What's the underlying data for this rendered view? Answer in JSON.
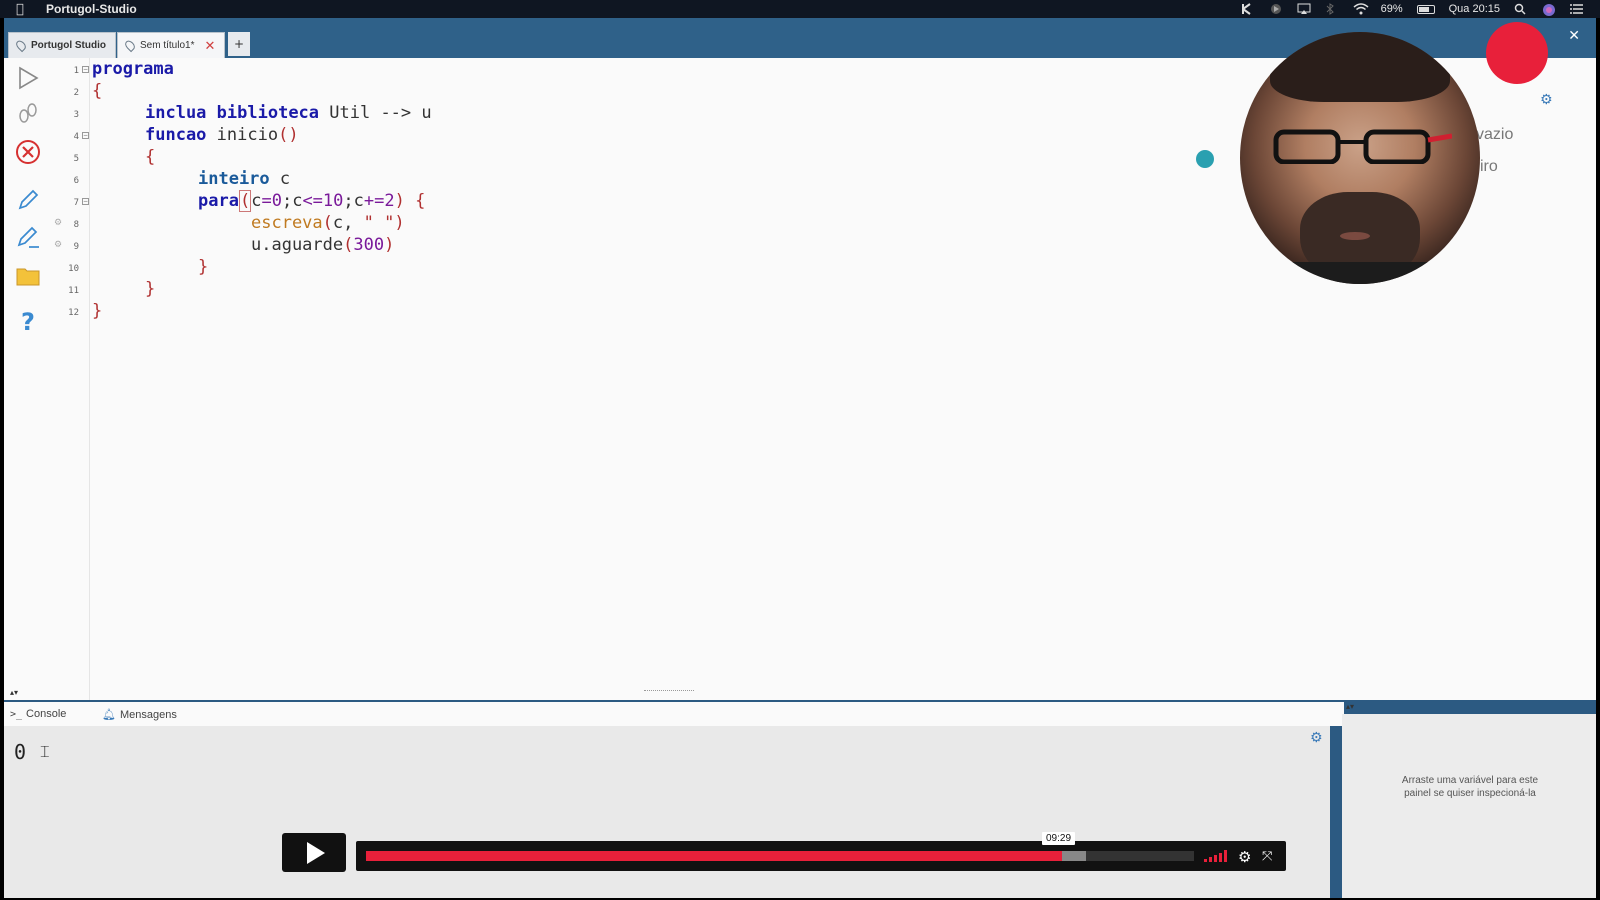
{
  "menubar": {
    "app_name": "Portugol-Studio",
    "battery": "69%",
    "clock": "Qua 20:15"
  },
  "tabs": {
    "home_label": "Portugol Studio",
    "file_label": "Sem título1*",
    "close_glyph": "✕",
    "add_glyph": "+"
  },
  "code": {
    "lines": [
      {
        "n": "1"
      },
      {
        "n": "2"
      },
      {
        "n": "3"
      },
      {
        "n": "4"
      },
      {
        "n": "5"
      },
      {
        "n": "6"
      },
      {
        "n": "7"
      },
      {
        "n": "8"
      },
      {
        "n": "9"
      },
      {
        "n": "10"
      },
      {
        "n": "11"
      },
      {
        "n": "12"
      }
    ],
    "t_programa": "programa",
    "t_open1": "{",
    "t_inclua": "inclua",
    "t_biblioteca": "biblioteca",
    "t_util": " Util --> u",
    "t_funcao": "funcao",
    "t_inicio": " inicio",
    "t_parens": "()",
    "t_open2": "{",
    "t_inteiro": "inteiro",
    "t_c": " c",
    "t_para": "para",
    "t_lp": "(",
    "t_c0": "c",
    "t_eq": "=",
    "t_0": "0",
    "t_semi1": ";c",
    "t_le": "<=",
    "t_10": "10",
    "t_semi2": ";c",
    "t_pe": "+=",
    "t_2": "2",
    "t_rp": ")",
    "t_ob": " {",
    "t_escreva": "escreva",
    "t_eargs1": "(",
    "t_eargs2": "c, ",
    "t_estr": "\" \"",
    "t_eargs3": ")",
    "t_u": "u.aguarde",
    "t_alp": "(",
    "t_300": "300",
    "t_arp": ")",
    "t_close3": "}",
    "t_close2": "}",
    "t_close1": "}"
  },
  "right_panel": {
    "partial1": "vazio",
    "partial2": "iro"
  },
  "bottom": {
    "console_tab": "Console",
    "messages_tab": "Mensagens",
    "console_output": "0",
    "inspector_hint_1": "Arraste uma variável para este",
    "inspector_hint_2": "painel se quiser inspecioná-la"
  },
  "player": {
    "time_tooltip": "09:29",
    "progress_fraction": 0.84,
    "buffer_fraction": 0.87
  },
  "colors": {
    "accent_red": "#e8203a",
    "window_blue": "#2c5a82"
  }
}
